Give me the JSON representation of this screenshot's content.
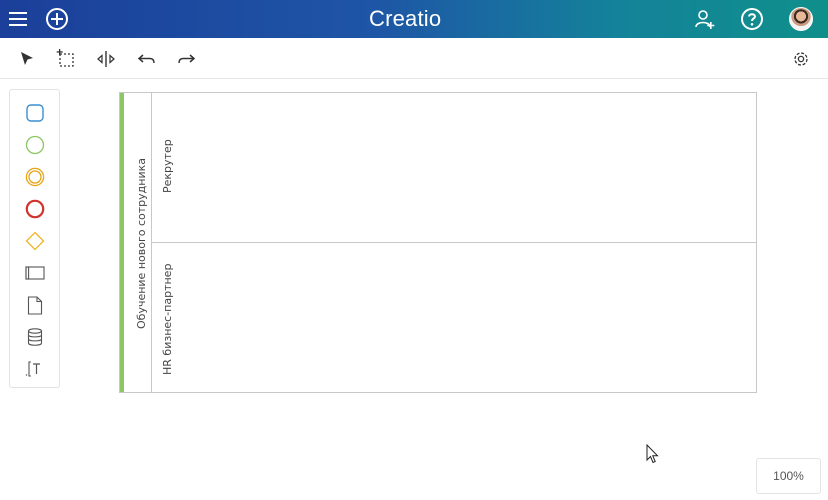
{
  "header": {
    "logo": "Creatio",
    "gradient_from": "#1b3f9a",
    "gradient_to": "#0f8f8a",
    "icons": [
      "menu-icon",
      "add-circle-icon",
      "add-user-icon",
      "help-icon",
      "avatar"
    ]
  },
  "toolbar": {
    "tools": [
      "pointer-icon",
      "lasso-select-icon",
      "space-tool-icon",
      "undo-icon",
      "redo-icon"
    ],
    "settings_icon": "gear-icon"
  },
  "palette": {
    "items": [
      "task-icon",
      "start-event-icon",
      "intermediate-event-icon",
      "end-event-icon",
      "gateway-icon",
      "subprocess-icon",
      "data-object-icon",
      "data-store-icon",
      "text-annotation-icon"
    ],
    "colors": {
      "task": "#3a8fd1",
      "start": "#8dc665",
      "intermediate": "#e8a317",
      "end": "#d0342c",
      "gateway": "#f0b429"
    }
  },
  "diagram": {
    "pool_name": "Обучение нового сотрудника",
    "pool_accent": "#8dc665",
    "lanes": [
      {
        "name": "Рекрутер"
      },
      {
        "name": "HR бизнес-партнер"
      }
    ]
  },
  "zoom": {
    "level": "100%"
  }
}
